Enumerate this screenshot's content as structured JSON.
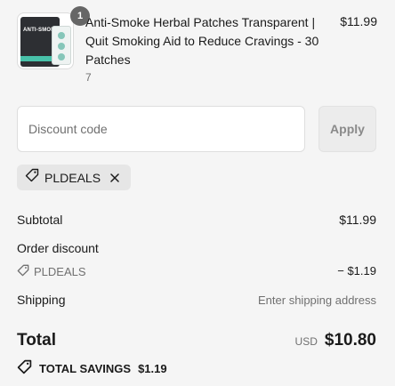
{
  "product": {
    "image_box_text": "ANTI-SMOKE",
    "quantity_badge": "1",
    "title": "Anti-Smoke Herbal Patches Transparent | Quit Smoking Aid to Reduce Cravings - 30 Patches",
    "variant": "7",
    "price": "$11.99"
  },
  "discount": {
    "placeholder": "Discount code",
    "value": "",
    "apply_label": "Apply"
  },
  "applied_code": {
    "label": "PLDEALS",
    "icon": "tag-icon",
    "remove_icon": "close-icon"
  },
  "summary": {
    "subtotal_label": "Subtotal",
    "subtotal_value": "$11.99",
    "order_discount_label": "Order discount",
    "discount_code": "PLDEALS",
    "discount_value": "− $1.19",
    "shipping_label": "Shipping",
    "shipping_value": "Enter shipping address"
  },
  "total": {
    "label": "Total",
    "currency": "USD",
    "amount": "$10.80"
  },
  "savings": {
    "label": "TOTAL SAVINGS",
    "amount": "$1.19"
  },
  "colors": {
    "background": "#f5f5f5",
    "chip_background": "#e6e6e6",
    "muted_text": "#707070",
    "accent_teal": "#48c1a9"
  }
}
